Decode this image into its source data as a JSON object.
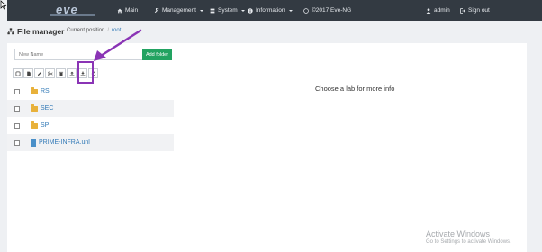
{
  "nav": {
    "logo": "eve",
    "items": [
      {
        "label": "Main",
        "icon": "home-icon",
        "caret": false
      },
      {
        "label": "Management",
        "icon": "wrench-icon",
        "caret": true
      },
      {
        "label": "System",
        "icon": "server-icon",
        "caret": true
      },
      {
        "label": "Information",
        "icon": "info-icon",
        "caret": true
      },
      {
        "label": "©2017 Eve-NG",
        "icon": "copyright-icon",
        "caret": false
      }
    ],
    "user": {
      "label": "admin",
      "icon": "user-icon"
    },
    "signout": {
      "label": "Sign out",
      "icon": "sign-out-icon"
    }
  },
  "header": {
    "title": "File manager",
    "breadcrumb_label": "Current position",
    "breadcrumb_link": "root"
  },
  "form": {
    "placeholder": "New Name",
    "add_folder": "Add folder",
    "add_folder_color": "#22a361"
  },
  "toolbar": [
    {
      "name": "select-all-icon",
      "glyph": "□"
    },
    {
      "name": "new-file-icon",
      "glyph": "▤"
    },
    {
      "name": "rename-icon",
      "glyph": "✎"
    },
    {
      "name": "cut-icon",
      "glyph": "✂"
    },
    {
      "name": "delete-icon",
      "glyph": "🗑"
    },
    {
      "name": "export-icon",
      "glyph": "⇧"
    },
    {
      "name": "import-icon",
      "glyph": "⇪"
    },
    {
      "name": "refresh-icon",
      "glyph": "↻"
    }
  ],
  "files": [
    {
      "type": "folder",
      "name": "RS"
    },
    {
      "type": "folder",
      "name": "SEC"
    },
    {
      "type": "folder",
      "name": "SP"
    },
    {
      "type": "file",
      "name": "PRIME-INFRA.unl"
    }
  ],
  "info": "Choose a lab for more info",
  "watermark": {
    "title": "Activate Windows",
    "subtitle": "Go to Settings to activate Windows."
  },
  "colors": {
    "navbar": "#333a42",
    "highlight": "#8a34b5",
    "folder": "#e8b13a",
    "link": "#337ab7"
  }
}
